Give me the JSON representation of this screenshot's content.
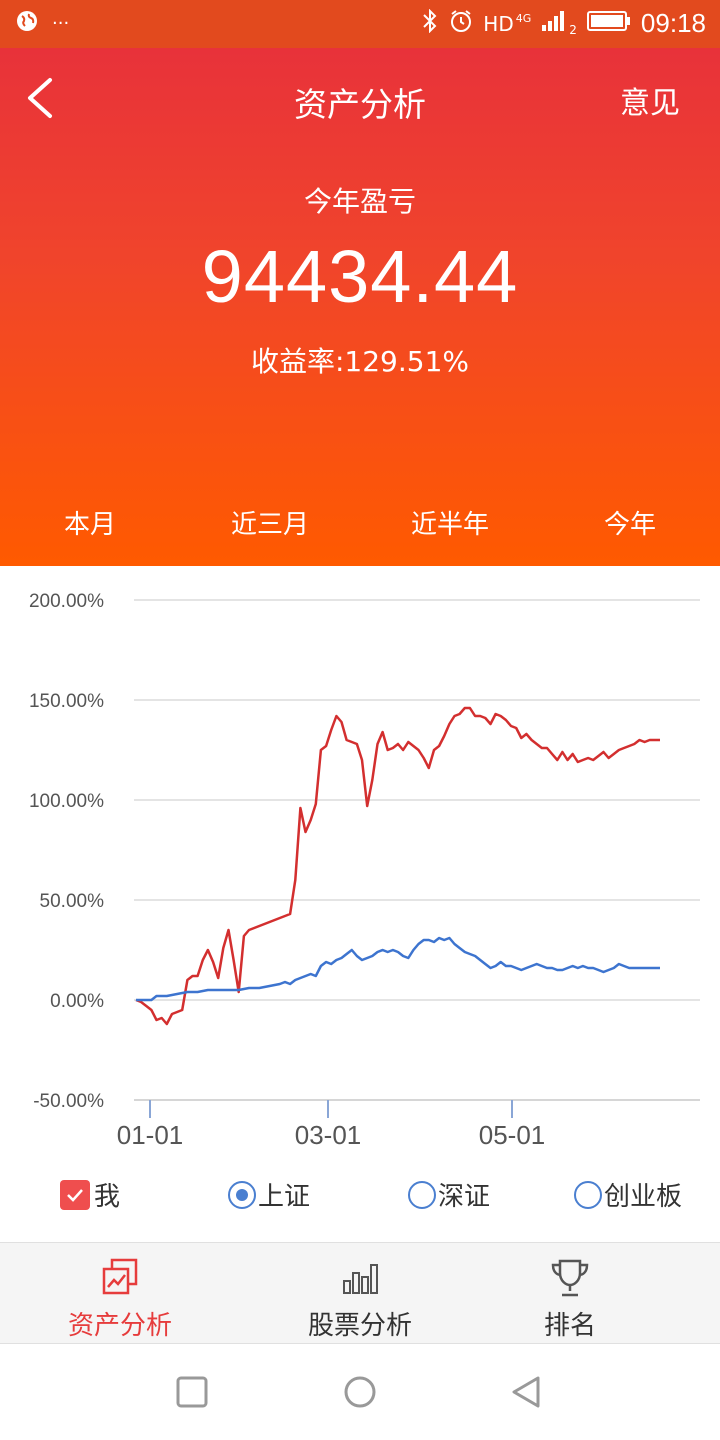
{
  "status_bar": {
    "network": "HD",
    "signal_type": "4G",
    "sim_slot": "2",
    "time": "09:18",
    "icons": [
      "globe-icon",
      "more-icon",
      "bluetooth-icon",
      "alarm-icon",
      "signal-icon",
      "battery-icon"
    ]
  },
  "header": {
    "title": "资产分析",
    "feedback": "意见",
    "back_icon": "back-arrow-icon"
  },
  "summary": {
    "label": "今年盈亏",
    "value": "94434.44",
    "rate": "收益率:129.51%"
  },
  "tabs": [
    {
      "label": "本月",
      "active": false
    },
    {
      "label": "近三月",
      "active": false
    },
    {
      "label": "近半年",
      "active": false
    },
    {
      "label": "今年",
      "active": true
    }
  ],
  "chart_data": {
    "type": "line",
    "y_ticks": [
      "200.00%",
      "150.00%",
      "100.00%",
      "50.00%",
      "0.00%",
      "-50.00%"
    ],
    "ylim": [
      -50,
      200
    ],
    "x_ticks": [
      "01-01",
      "03-01",
      "05-01"
    ],
    "grid": true,
    "series": [
      {
        "name": "我",
        "color": "#d32f2f",
        "points": [
          [
            0,
            0
          ],
          [
            1,
            -1
          ],
          [
            2,
            -3
          ],
          [
            3,
            -5
          ],
          [
            4,
            -10
          ],
          [
            5,
            -9
          ],
          [
            6,
            -12
          ],
          [
            7,
            -7
          ],
          [
            8,
            -6
          ],
          [
            9,
            -5
          ],
          [
            10,
            10
          ],
          [
            11,
            12
          ],
          [
            12,
            12
          ],
          [
            13,
            20
          ],
          [
            14,
            25
          ],
          [
            15,
            19
          ],
          [
            16,
            11
          ],
          [
            17,
            26
          ],
          [
            18,
            35
          ],
          [
            19,
            20
          ],
          [
            20,
            4
          ],
          [
            21,
            32
          ],
          [
            22,
            35
          ],
          [
            30,
            43
          ],
          [
            31,
            60
          ],
          [
            32,
            96
          ],
          [
            33,
            84
          ],
          [
            34,
            90
          ],
          [
            35,
            98
          ],
          [
            36,
            125
          ],
          [
            37,
            127
          ],
          [
            38,
            135
          ],
          [
            39,
            142
          ],
          [
            40,
            139
          ],
          [
            41,
            130
          ],
          [
            42,
            129
          ],
          [
            43,
            128
          ],
          [
            44,
            120
          ],
          [
            45,
            97
          ],
          [
            46,
            110
          ],
          [
            47,
            128
          ],
          [
            48,
            134
          ],
          [
            49,
            125
          ],
          [
            50,
            126
          ],
          [
            51,
            128
          ],
          [
            52,
            125
          ],
          [
            53,
            129
          ],
          [
            54,
            127
          ],
          [
            55,
            125
          ],
          [
            56,
            121
          ],
          [
            57,
            116
          ],
          [
            58,
            125
          ],
          [
            59,
            127
          ],
          [
            60,
            132
          ],
          [
            61,
            138
          ],
          [
            62,
            142
          ],
          [
            63,
            143
          ],
          [
            64,
            146
          ],
          [
            65,
            146
          ],
          [
            66,
            142
          ],
          [
            67,
            142
          ],
          [
            68,
            141
          ],
          [
            69,
            138
          ],
          [
            70,
            143
          ],
          [
            71,
            142
          ],
          [
            72,
            140
          ],
          [
            73,
            137
          ],
          [
            74,
            136
          ],
          [
            75,
            131
          ],
          [
            76,
            133
          ],
          [
            77,
            130
          ],
          [
            78,
            128
          ],
          [
            79,
            126
          ],
          [
            80,
            126
          ],
          [
            81,
            123
          ],
          [
            82,
            120
          ],
          [
            83,
            124
          ],
          [
            84,
            120
          ],
          [
            85,
            123
          ],
          [
            86,
            119
          ],
          [
            87,
            120
          ],
          [
            88,
            121
          ],
          [
            89,
            120
          ],
          [
            90,
            122
          ],
          [
            91,
            124
          ],
          [
            92,
            121
          ],
          [
            93,
            123
          ],
          [
            94,
            125
          ],
          [
            95,
            126
          ],
          [
            96,
            127
          ],
          [
            97,
            128
          ],
          [
            98,
            130
          ],
          [
            99,
            129
          ],
          [
            100,
            130
          ],
          [
            101,
            130
          ],
          [
            102,
            130
          ]
        ]
      },
      {
        "name": "上证",
        "color": "#3d74cf",
        "points": [
          [
            0,
            0
          ],
          [
            3,
            0
          ],
          [
            4,
            2
          ],
          [
            6,
            2
          ],
          [
            8,
            3
          ],
          [
            10,
            4
          ],
          [
            12,
            4
          ],
          [
            14,
            5
          ],
          [
            16,
            5
          ],
          [
            18,
            5
          ],
          [
            20,
            5
          ],
          [
            22,
            6
          ],
          [
            24,
            6
          ],
          [
            26,
            7
          ],
          [
            28,
            8
          ],
          [
            29,
            9
          ],
          [
            30,
            8
          ],
          [
            31,
            10
          ],
          [
            32,
            11
          ],
          [
            34,
            13
          ],
          [
            35,
            12
          ],
          [
            36,
            17
          ],
          [
            37,
            19
          ],
          [
            38,
            18
          ],
          [
            39,
            20
          ],
          [
            40,
            21
          ],
          [
            41,
            23
          ],
          [
            42,
            25
          ],
          [
            43,
            22
          ],
          [
            44,
            20
          ],
          [
            45,
            21
          ],
          [
            46,
            22
          ],
          [
            47,
            24
          ],
          [
            48,
            25
          ],
          [
            49,
            24
          ],
          [
            50,
            25
          ],
          [
            51,
            24
          ],
          [
            52,
            22
          ],
          [
            53,
            21
          ],
          [
            54,
            25
          ],
          [
            55,
            28
          ],
          [
            56,
            30
          ],
          [
            57,
            30
          ],
          [
            58,
            29
          ],
          [
            59,
            31
          ],
          [
            60,
            30
          ],
          [
            61,
            31
          ],
          [
            62,
            28
          ],
          [
            63,
            26
          ],
          [
            64,
            24
          ],
          [
            65,
            23
          ],
          [
            66,
            22
          ],
          [
            67,
            20
          ],
          [
            68,
            18
          ],
          [
            69,
            16
          ],
          [
            70,
            17
          ],
          [
            71,
            19
          ],
          [
            72,
            17
          ],
          [
            73,
            17
          ],
          [
            74,
            16
          ],
          [
            75,
            15
          ],
          [
            76,
            16
          ],
          [
            77,
            17
          ],
          [
            78,
            18
          ],
          [
            79,
            17
          ],
          [
            80,
            16
          ],
          [
            81,
            16
          ],
          [
            82,
            15
          ],
          [
            83,
            15
          ],
          [
            84,
            16
          ],
          [
            85,
            17
          ],
          [
            86,
            16
          ],
          [
            87,
            17
          ],
          [
            88,
            16
          ],
          [
            89,
            16
          ],
          [
            90,
            15
          ],
          [
            91,
            14
          ],
          [
            92,
            15
          ],
          [
            93,
            16
          ],
          [
            94,
            18
          ],
          [
            95,
            17
          ],
          [
            96,
            16
          ],
          [
            97,
            16
          ],
          [
            98,
            16
          ],
          [
            99,
            16
          ],
          [
            100,
            16
          ],
          [
            101,
            16
          ],
          [
            102,
            16
          ]
        ]
      }
    ]
  },
  "legend": [
    {
      "label": "我",
      "type": "checkbox",
      "checked": true
    },
    {
      "label": "上证",
      "type": "radio",
      "checked": true
    },
    {
      "label": "深证",
      "type": "radio",
      "checked": false
    },
    {
      "label": "创业板",
      "type": "radio",
      "checked": false
    }
  ],
  "bottom_nav": [
    {
      "label": "资产分析",
      "icon": "asset-chart-icon",
      "active": true
    },
    {
      "label": "股票分析",
      "icon": "bar-chart-icon",
      "active": false
    },
    {
      "label": "排名",
      "icon": "trophy-icon",
      "active": false
    }
  ],
  "system_nav": [
    "recent-apps-icon",
    "home-icon",
    "back-triangle-icon"
  ]
}
